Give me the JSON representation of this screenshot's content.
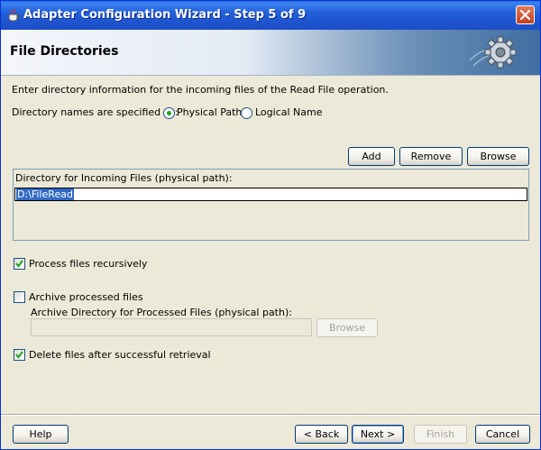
{
  "window": {
    "title": "Adapter Configuration Wizard - Step 5 of 9",
    "close_icon": "close-icon",
    "colors": {
      "title_bar": "#245edb",
      "face": "#ece9d8",
      "selection": "#316ac5"
    }
  },
  "banner": {
    "title": "File Directories",
    "art_icon": "gear-icon"
  },
  "intro_text": "Enter directory information for the incoming files of the Read File operation.",
  "directory_names": {
    "label": "Directory names are specified as:",
    "options": [
      {
        "label": "Physical Path",
        "selected": true
      },
      {
        "label": "Logical Name",
        "selected": false
      }
    ]
  },
  "table_buttons": {
    "add": "Add",
    "remove": "Remove",
    "browse": "Browse"
  },
  "incoming_table": {
    "header": "Directory for Incoming Files (physical path):",
    "rows": [
      "D:\\FileRead"
    ]
  },
  "process_recursively": {
    "label": "Process files recursively",
    "checked": true
  },
  "archive": {
    "label": "Archive processed files",
    "checked": false,
    "dir_label": "Archive Directory for Processed Files (physical path):",
    "dir_value": "",
    "browse_label": "Browse"
  },
  "delete_after": {
    "label": "Delete files after successful retrieval",
    "checked": true
  },
  "footer": {
    "help": "Help",
    "back": "< Back",
    "next": "Next >",
    "finish": "Finish",
    "cancel": "Cancel"
  }
}
